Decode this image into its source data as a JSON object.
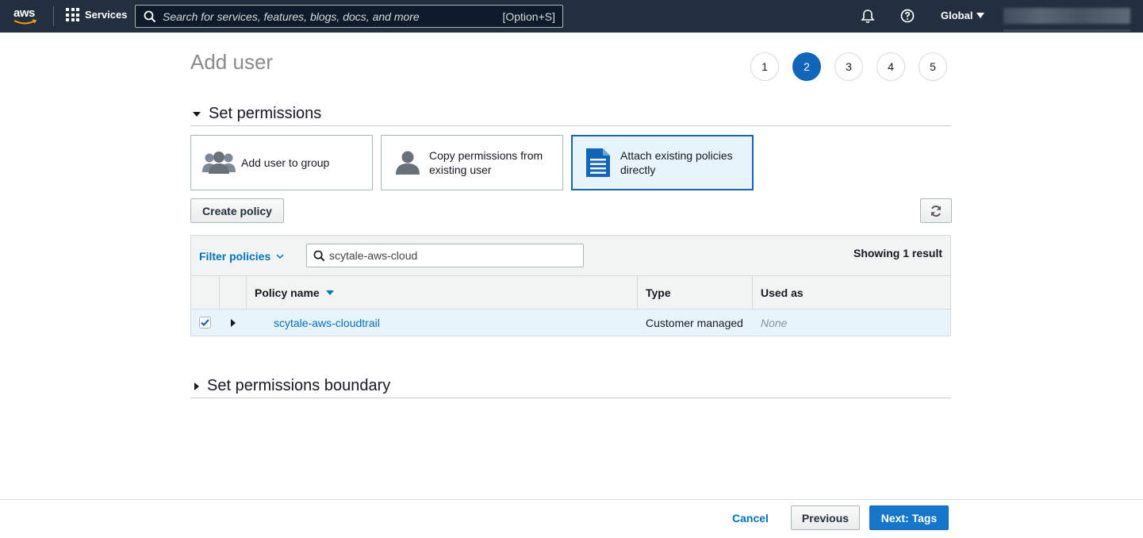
{
  "topnav": {
    "logo": "aws",
    "services_label": "Services",
    "search_placeholder": "Search for services, features, blogs, docs, and more",
    "search_shortcut": "[Option+S]",
    "region": "Global",
    "icons": [
      "grid-icon",
      "search-icon",
      "bell-icon",
      "help-icon",
      "caret-down-icon"
    ]
  },
  "page": {
    "title": "Add user",
    "steps": [
      "1",
      "2",
      "3",
      "4",
      "5"
    ],
    "active_step": "2"
  },
  "permissions": {
    "heading": "Set permissions",
    "options": [
      {
        "label": "Add user to group",
        "icon": "users-group-icon"
      },
      {
        "label_line1": "Copy permissions from",
        "label_line2": "existing user",
        "icon": "user-icon"
      },
      {
        "label_line1": "Attach existing policies",
        "label_line2": "directly",
        "icon": "document-icon",
        "selected": true
      }
    ],
    "create_policy": "Create policy"
  },
  "policy_table": {
    "filter_label": "Filter policies",
    "search_value": "scytale-aws-cloud",
    "showing": "Showing 1 result",
    "columns": [
      "Policy name",
      "Type",
      "Used as"
    ],
    "rows": [
      {
        "checked": true,
        "policy_name": "scytale-aws-cloudtrail",
        "type": "Customer managed",
        "used_as": "None"
      }
    ]
  },
  "boundary": {
    "heading": "Set permissions boundary"
  },
  "footer": {
    "cancel": "Cancel",
    "previous": "Previous",
    "next": "Next: Tags"
  },
  "colors": {
    "nav_bg": "#232f3e",
    "primary": "#1166bb",
    "link": "#0073bb",
    "selected_bg": "#e8f4fb"
  }
}
